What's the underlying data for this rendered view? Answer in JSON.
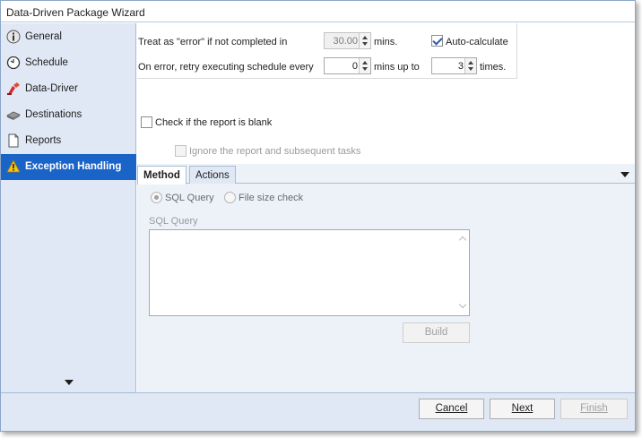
{
  "window": {
    "title": "Data-Driven Package Wizard"
  },
  "sidebar": {
    "items": [
      {
        "label": "General",
        "icon": "info-icon",
        "active": false
      },
      {
        "label": "Schedule",
        "icon": "clock-icon",
        "active": false
      },
      {
        "label": "Data-Driver",
        "icon": "data-driver-icon",
        "active": false
      },
      {
        "label": "Destinations",
        "icon": "destinations-icon",
        "active": false
      },
      {
        "label": "Reports",
        "icon": "document-icon",
        "active": false
      },
      {
        "label": "Exception Handling",
        "icon": "warning-icon",
        "active": true
      }
    ],
    "more_icon": "chevron-down-icon"
  },
  "options": {
    "treat_error_prefix": "Treat as \"error\" if not completed in",
    "timeout_value": "30.00",
    "timeout_unit": "mins.",
    "auto_calculate_label": "Auto-calculate",
    "auto_calculate_checked": true,
    "retry_prefix": "On error, retry  executing schedule every",
    "retry_interval_value": "0",
    "retry_interval_unit": "mins up to",
    "retry_times_value": "3",
    "retry_times_unit": "times."
  },
  "blank_check": {
    "label": "Check if the report is blank",
    "checked": false,
    "ignore_label": "Ignore the report and subsequent tasks",
    "ignore_checked": false
  },
  "tabs": [
    {
      "label": "Method",
      "active": true
    },
    {
      "label": "Actions",
      "active": false
    }
  ],
  "method": {
    "radio_sql_label": "SQL Query",
    "radio_sql_selected": true,
    "radio_file_size_label": "File size check",
    "sql_query_label": "SQL Query",
    "sql_query_value": "",
    "build_label": "Build"
  },
  "footer": {
    "cancel_label": "Cancel",
    "next_label": "Next",
    "finish_label": "Finish"
  },
  "colors": {
    "accent": "#1a64c8",
    "sidebar_bg": "#dfe8f4",
    "panel_bg": "#edf2f9"
  }
}
